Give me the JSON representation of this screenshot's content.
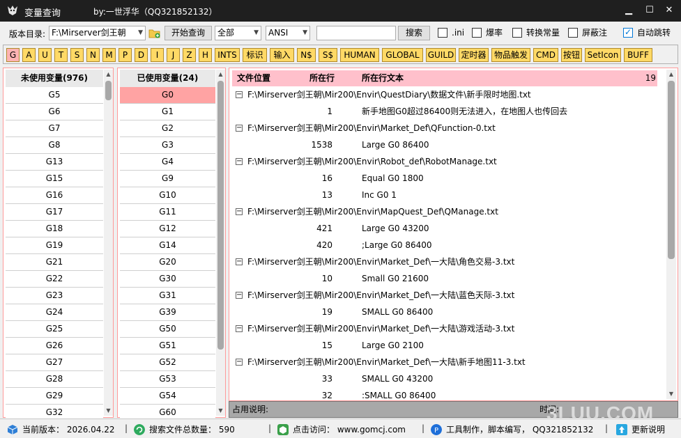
{
  "window": {
    "title": "变量查询",
    "byline": "by:一世浮华（QQ321852132）",
    "minimize": "▁",
    "maximize": "☐",
    "close": "✕"
  },
  "toolbar": {
    "version_dir_label": "版本目录:",
    "version_dir_value": "F:\\Mirserver剑王朝",
    "start_query": "开始查询",
    "scope_value": "全部",
    "encoding_value": "ANSI",
    "search_value": "",
    "search_button": "搜索",
    "checkboxes": [
      {
        "label": ".ini",
        "checked": false
      },
      {
        "label": "爆率",
        "checked": false
      },
      {
        "label": "转换常量",
        "checked": false
      },
      {
        "label": "屏蔽注",
        "checked": false
      },
      {
        "label": "自动跳转",
        "checked": true
      }
    ]
  },
  "letter_buttons": [
    "G",
    "A",
    "U",
    "T",
    "S",
    "N",
    "M",
    "P",
    "D",
    "I",
    "J",
    "Z",
    "H",
    "INTS",
    "标识",
    "输入",
    "N$",
    "S$",
    "HUMAN",
    "GLOBAL",
    "GUILD",
    "定时器",
    "物品触发",
    "CMD",
    "按钮",
    "SetIcon",
    "BUFF"
  ],
  "selected_letter": "G",
  "unused": {
    "title": "未使用变量(976)",
    "items": [
      "G5",
      "G6",
      "G7",
      "G8",
      "G13",
      "G15",
      "G16",
      "G17",
      "G18",
      "G19",
      "G21",
      "G22",
      "G23",
      "G24",
      "G25",
      "G26",
      "G27",
      "G28",
      "G29",
      "G32"
    ]
  },
  "used": {
    "title": "已使用变量(24)",
    "selected": "G0",
    "items": [
      "G0",
      "G1",
      "G2",
      "G3",
      "G4",
      "G9",
      "G10",
      "G11",
      "G12",
      "G14",
      "G20",
      "G30",
      "G31",
      "G39",
      "G50",
      "G51",
      "G52",
      "G53",
      "G54",
      "G60"
    ]
  },
  "results": {
    "col_file": "文件位置",
    "col_line": "所在行",
    "col_text": "所在行文本",
    "count": "19",
    "toggle": "−",
    "rows": [
      {
        "type": "file",
        "text": "F:\\Mirserver剑王朝\\Mir200\\Envir\\QuestDiary\\数据文件\\新手限时地图.txt"
      },
      {
        "type": "line",
        "line": "1",
        "text": "新手地图G0超过86400则无法进入，在地图人也传回去"
      },
      {
        "type": "file",
        "text": "F:\\Mirserver剑王朝\\Mir200\\Envir\\Market_Def\\QFunction-0.txt"
      },
      {
        "type": "line",
        "line": "1538",
        "text": "Large G0 86400"
      },
      {
        "type": "file",
        "text": "F:\\Mirserver剑王朝\\Mir200\\Envir\\Robot_def\\RobotManage.txt"
      },
      {
        "type": "line",
        "line": "16",
        "text": "Equal G0 1800"
      },
      {
        "type": "line",
        "line": "13",
        "text": "Inc G0 1"
      },
      {
        "type": "file",
        "text": "F:\\Mirserver剑王朝\\Mir200\\Envir\\MapQuest_Def\\QManage.txt"
      },
      {
        "type": "line",
        "line": "421",
        "text": "Large G0 43200"
      },
      {
        "type": "line",
        "line": "420",
        "text": ";Large G0 86400"
      },
      {
        "type": "file",
        "text": "F:\\Mirserver剑王朝\\Mir200\\Envir\\Market_Def\\一大陆\\角色交易-3.txt"
      },
      {
        "type": "line",
        "line": "10",
        "text": "Small G0 21600"
      },
      {
        "type": "file",
        "text": "F:\\Mirserver剑王朝\\Mir200\\Envir\\Market_Def\\一大陆\\蓝色天际-3.txt"
      },
      {
        "type": "line",
        "line": "19",
        "text": "SMALL G0 86400"
      },
      {
        "type": "file",
        "text": "F:\\Mirserver剑王朝\\Mir200\\Envir\\Market_Def\\一大陆\\游戏活动-3.txt"
      },
      {
        "type": "line",
        "line": "15",
        "text": "Large G0 2100"
      },
      {
        "type": "file",
        "text": "F:\\Mirserver剑王朝\\Mir200\\Envir\\Market_Def\\一大陆\\新手地图11-3.txt"
      },
      {
        "type": "line",
        "line": "33",
        "text": "SMALL G0 43200"
      },
      {
        "type": "line",
        "line": "32",
        "text": ":SMALL G0 86400"
      }
    ]
  },
  "infobar": {
    "usage_label": "占用说明:",
    "time_label": "时间:"
  },
  "statusbar": {
    "version": "当前版本：  2026.04.22",
    "file_count": "搜索文件总数量：  590",
    "visit": "点击访问：  www.gomcj.com",
    "author": "工具制作，脚本编写，  QQ321852132",
    "update": "更新说明",
    "sep": "|"
  },
  "watermark": "3LUU.COM"
}
